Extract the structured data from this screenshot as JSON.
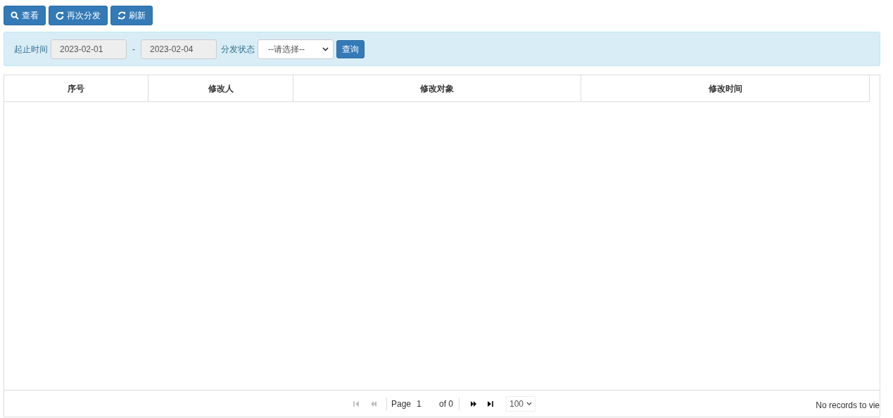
{
  "toolbar": [
    {
      "kind": "search",
      "label": "查看"
    },
    {
      "kind": "redo",
      "label": "再次分发"
    },
    {
      "kind": "refresh",
      "label": "刷新"
    }
  ],
  "filter": {
    "range_label": "起止时间",
    "start": "2023-02-01",
    "separator": "-",
    "end": "2023-02-04",
    "status_label": "分发状态",
    "status_value": "--请选择--",
    "query_button": "查询"
  },
  "table": {
    "columns": [
      "序号",
      "修改人",
      "修改对象",
      "修改时间"
    ]
  },
  "pager": {
    "buttons": [
      {
        "kind": "first",
        "disabled": true
      },
      {
        "kind": "prev",
        "disabled": true
      }
    ],
    "page_label": "Page",
    "page": "1",
    "of_label": "of 0",
    "next_buttons": [
      {
        "kind": "next",
        "disabled": false
      },
      {
        "kind": "last",
        "disabled": false
      }
    ],
    "page_size": "100",
    "records": "No records to vie"
  }
}
